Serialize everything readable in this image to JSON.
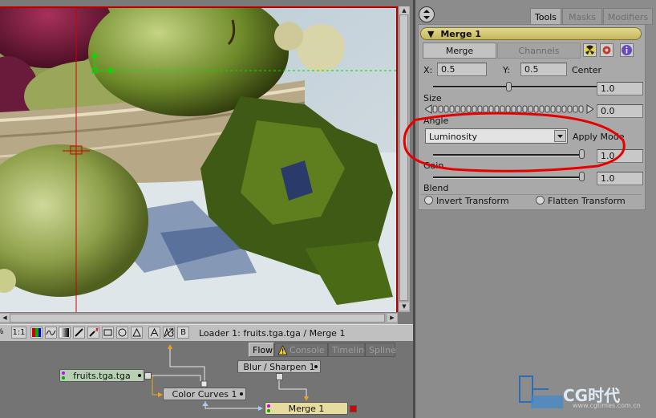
{
  "viewer": {
    "toolbar": {
      "buttons": [
        "%",
        "1:1",
        "B"
      ],
      "status": "Loader 1: fruits.tga.tga / Merge 1"
    }
  },
  "flow": {
    "tabs": [
      {
        "label": "Flow",
        "active": true
      },
      {
        "label": "Console",
        "active": false
      },
      {
        "label": "Timeline",
        "active": false
      },
      {
        "label": "Spline",
        "active": false
      }
    ],
    "nodes": {
      "loader": "fruits.tga.tga",
      "color_curves": "Color Curves 1",
      "blur": "Blur / Sharpen 1",
      "merge": "Merge 1"
    }
  },
  "panel": {
    "tabs": [
      {
        "label": "Tools",
        "active": true
      },
      {
        "label": "Masks",
        "active": false
      },
      {
        "label": "Modifiers",
        "active": false
      }
    ],
    "tool_name": "Merge 1",
    "subtabs": [
      {
        "label": "Merge",
        "active": true
      },
      {
        "label": "Channels",
        "active": false
      }
    ],
    "center": {
      "x_label": "X:",
      "x_value": "0.5",
      "y_label": "Y:",
      "y_value": "0.5",
      "label": "Center"
    },
    "fields": {
      "center_slider": "1.0",
      "size_label": "Size",
      "size_value": "0.0",
      "angle_label": "Angle",
      "apply_mode_select": "Luminosity",
      "apply_mode_label": "Apply Mode",
      "apply_slider": "1.0",
      "gain_label": "Gain",
      "gain_value": "1.0",
      "blend_label": "Blend"
    },
    "options": {
      "invert": "Invert Transform",
      "flatten": "Flatten Transform"
    }
  },
  "watermark": {
    "text": "CG时代",
    "url": "www.cgtimes.com.cn"
  },
  "colors": {
    "annotation": "#e60000",
    "tool_header": "#d6c77a",
    "node_merge": "#e6dca0",
    "node_loader": "#b6d0b1",
    "viewer_border": "#b60000"
  }
}
